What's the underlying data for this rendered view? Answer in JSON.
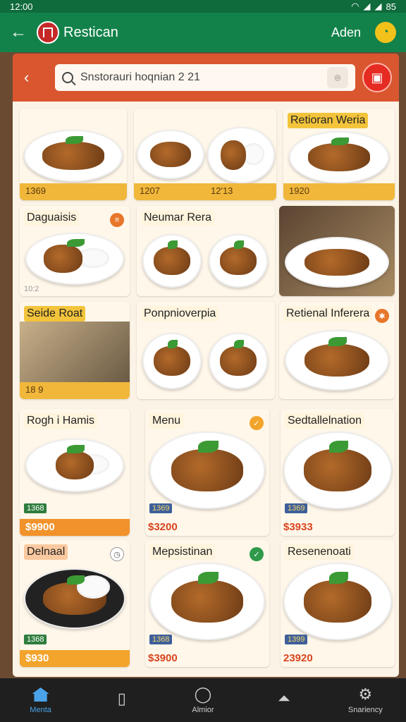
{
  "status": {
    "time": "12:00",
    "battery": "85"
  },
  "appbar": {
    "title": "Restican",
    "action": "Aden"
  },
  "search": {
    "text": "Snstorauri hoqnian 2 21"
  },
  "cards": [
    {
      "prices": [
        "1369",
        "1207",
        "12'13",
        "1920"
      ],
      "title3": "Retioran Weria"
    },
    {
      "title": "Daguaisis",
      "small": "10:2"
    },
    {
      "title": "Neumar Rera"
    },
    {
      "title": "Seide Roat",
      "small": "18 9"
    },
    {
      "title": "Ponpnioverpia"
    },
    {
      "title": "Retienal Inferera"
    },
    {
      "title": "Rogh i Hamis",
      "tag": "1368",
      "price": "$9900"
    },
    {
      "title": "Menu",
      "tag": "1369",
      "price": "$3200"
    },
    {
      "title": "Sedtallelnation",
      "tag": "1369",
      "price": "$3933"
    },
    {
      "title": "Delnaal",
      "tag": "1368",
      "price": "$930"
    },
    {
      "title": "Mepsistinan",
      "tag": "1368",
      "price": "$3900"
    },
    {
      "title": "Resenenoati",
      "tag": "1399",
      "price": "23920"
    }
  ],
  "nav": [
    {
      "label": "Menta"
    },
    {
      "label": ""
    },
    {
      "label": "Almior"
    },
    {
      "label": ""
    },
    {
      "label": "Snariency"
    }
  ],
  "colors": {
    "brand": "#12824a",
    "accent": "#d9562f",
    "price": "#d8451f"
  }
}
